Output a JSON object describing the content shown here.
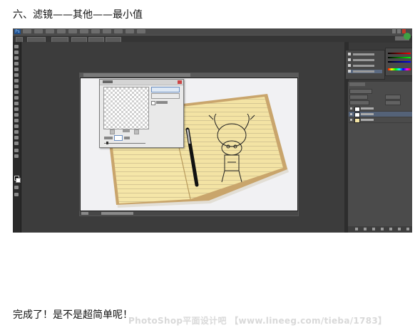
{
  "tutorial": {
    "heading": "六、滤镜——其他——最小值",
    "conclusion": "完成了！是不是超简单呢！",
    "watermark": "PhotoShop平面设计吧 【www.lineeg.com/tieba/1783】"
  },
  "photoshop": {
    "app_icon": "ps-logo-icon",
    "menu_count": 11,
    "dialog": {
      "name": "minimum-filter",
      "preview_checked": true
    },
    "layers_selected_index": 1,
    "colors": {
      "menubar": "#4a4a4a",
      "workspace": "#3c3c3c",
      "panel": "#4b4b4b",
      "selection": "#546278",
      "ok_accent": "#6b8fc2",
      "accent_green": "#3fa143"
    }
  }
}
